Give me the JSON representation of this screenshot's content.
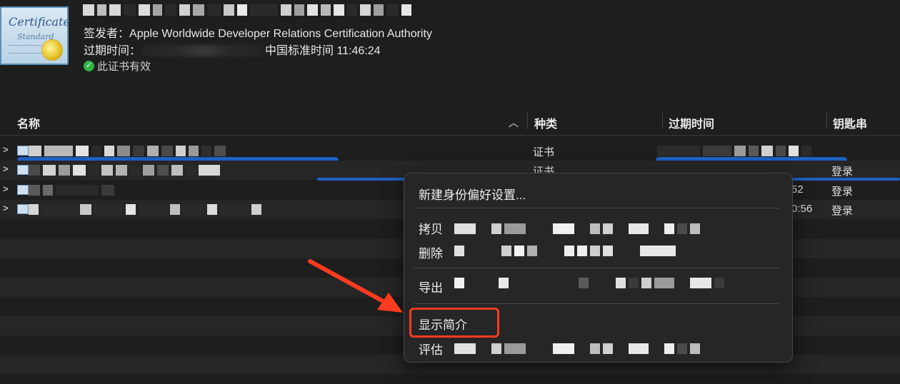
{
  "certificate": {
    "issuer_label": "签发者：",
    "issuer_value": "Apple Worldwide Developer Relations Certification Authority",
    "expiry_label": "过期时间：",
    "expiry_value": "中国标准时间 11:46:24",
    "valid_text": "此证书有效",
    "thumb_line1": "Certificate",
    "thumb_line2": "Standard"
  },
  "table": {
    "columns": {
      "name": "名称",
      "kind": "种类",
      "expires": "过期时间",
      "keychain": "钥匙串"
    },
    "rows": [
      {
        "kind": "证书",
        "expires": "",
        "keychain": ""
      },
      {
        "kind": "证书",
        "expires": "",
        "keychain": "登录"
      },
      {
        "kind": "",
        "expires": "52",
        "keychain": "登录"
      },
      {
        "kind": "",
        "expires": "0:56",
        "keychain": "登录"
      }
    ]
  },
  "context_menu": {
    "items": [
      "新建身份偏好设置...",
      "拷贝",
      "删除",
      "导出",
      "显示简介",
      "评估"
    ],
    "highlighted": "显示简介"
  },
  "colors": {
    "background": "#1e1e1e",
    "alt_row": "#262626",
    "selection": "#1f5fc4",
    "highlight": "#ff3b1f",
    "valid": "#2fb548"
  }
}
